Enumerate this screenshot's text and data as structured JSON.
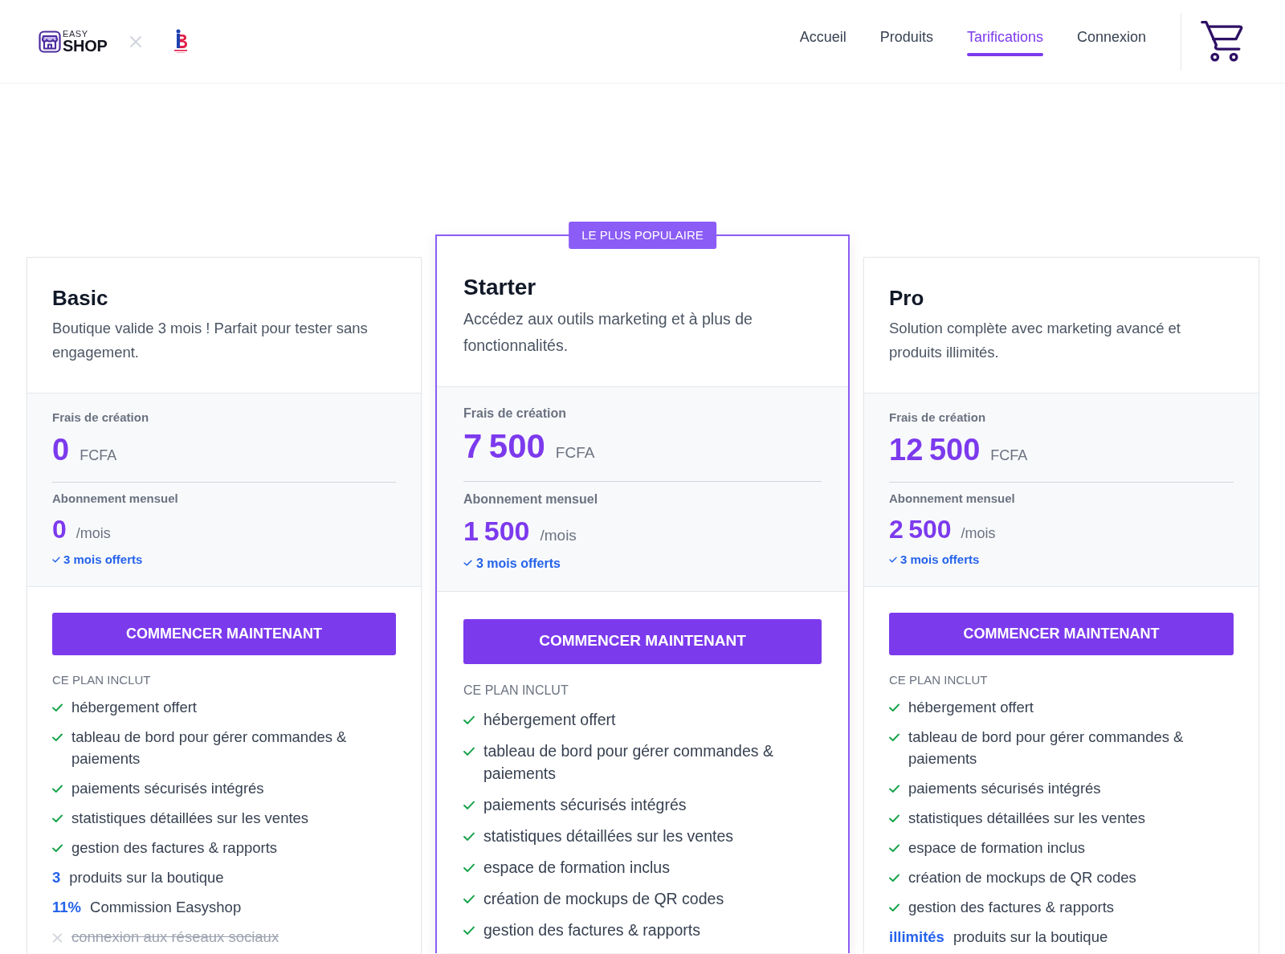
{
  "logo": {
    "line_1": "EASY",
    "line_2": "SHOP"
  },
  "nav": {
    "items": [
      {
        "label": "Accueil",
        "selected": false
      },
      {
        "label": "Produits",
        "selected": false
      },
      {
        "label": "Tarifications",
        "selected": true
      },
      {
        "label": "Connexion",
        "selected": false
      }
    ]
  },
  "plans": [
    {
      "name": "Basic",
      "featured": false,
      "description": "Boutique valide 3 mois ! Parfait pour tester sans engagement.",
      "setup_label": "Frais de création",
      "setup_price": "0",
      "setup_currency": "FCFA",
      "monthly_label": "Abonnement mensuel",
      "monthly_price": "0",
      "monthly_unit": "/mois",
      "offer": "3 mois offerts",
      "button": "COMMENCER MAINTENANT",
      "includes_label": "CE PLAN INCLUT",
      "features": [
        {
          "kind": "check",
          "text": "hébergement offert"
        },
        {
          "kind": "check",
          "text": "tableau de bord pour gérer commandes & paiements"
        },
        {
          "kind": "check",
          "text": "paiements sécurisés intégrés"
        },
        {
          "kind": "check",
          "text": "statistiques détaillées sur les ventes"
        },
        {
          "kind": "check",
          "text": "gestion des factures & rapports"
        },
        {
          "kind": "value",
          "value": "3",
          "text": "produits sur la boutique"
        },
        {
          "kind": "value",
          "value": "11%",
          "text": "Commission Easyshop"
        },
        {
          "kind": "excluded",
          "text": "connexion aux réseaux sociaux"
        }
      ]
    },
    {
      "name": "Starter",
      "featured": true,
      "badge": "LE PLUS POPULAIRE",
      "description": "Accédez aux outils marketing et à plus de fonctionnalités.",
      "setup_label": "Frais de création",
      "setup_price": "7 500",
      "setup_currency": "FCFA",
      "monthly_label": "Abonnement mensuel",
      "monthly_price": "1 500",
      "monthly_unit": "/mois",
      "offer": "3 mois offerts",
      "button": "COMMENCER MAINTENANT",
      "includes_label": "CE PLAN INCLUT",
      "features": [
        {
          "kind": "check",
          "text": "hébergement offert"
        },
        {
          "kind": "check",
          "text": "tableau de bord pour gérer commandes & paiements"
        },
        {
          "kind": "check",
          "text": "paiements sécurisés intégrés"
        },
        {
          "kind": "check",
          "text": "statistiques détaillées sur les ventes"
        },
        {
          "kind": "check",
          "text": "espace de formation inclus"
        },
        {
          "kind": "check",
          "text": "création de mockups de QR codes"
        },
        {
          "kind": "check",
          "text": "gestion des factures & rapports"
        }
      ]
    },
    {
      "name": "Pro",
      "featured": false,
      "description": "Solution complète avec marketing avancé et produits illimités.",
      "setup_label": "Frais de création",
      "setup_price": "12 500",
      "setup_currency": "FCFA",
      "monthly_label": "Abonnement mensuel",
      "monthly_price": "2 500",
      "monthly_unit": "/mois",
      "offer": "3 mois offerts",
      "button": "COMMENCER MAINTENANT",
      "includes_label": "CE PLAN INCLUT",
      "features": [
        {
          "kind": "check",
          "text": "hébergement offert"
        },
        {
          "kind": "check",
          "text": "tableau de bord pour gérer commandes & paiements"
        },
        {
          "kind": "check",
          "text": "paiements sécurisés intégrés"
        },
        {
          "kind": "check",
          "text": "statistiques détaillées sur les ventes"
        },
        {
          "kind": "check",
          "text": "espace de formation inclus"
        },
        {
          "kind": "check",
          "text": "création de mockups de QR codes"
        },
        {
          "kind": "check",
          "text": "gestion des factures & rapports"
        },
        {
          "kind": "value",
          "value": "illimités",
          "text": "produits sur la boutique"
        }
      ]
    }
  ]
}
